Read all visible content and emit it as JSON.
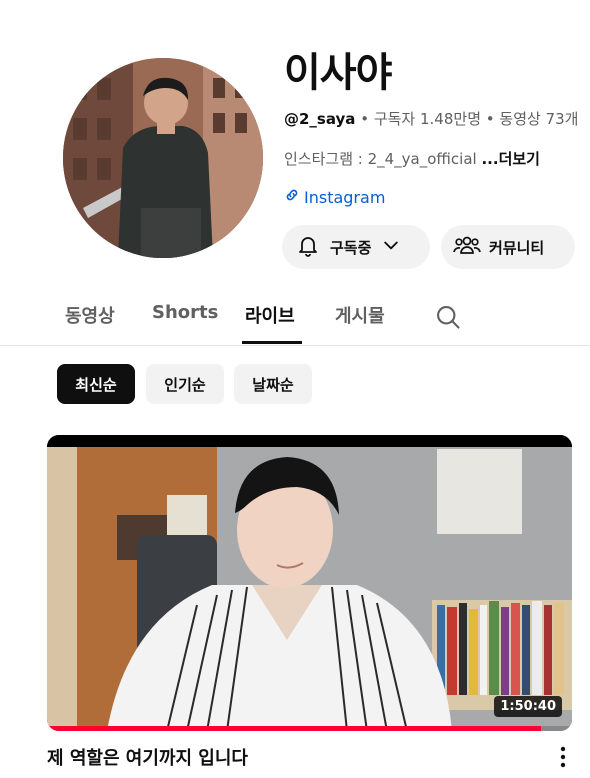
{
  "channel": {
    "name": "이사야",
    "handle": "@2_saya",
    "separator": " • ",
    "subscribers": "구독자 1.48만명",
    "videos": "동영상 73개",
    "description": "인스타그램 : 2_4_ya_official ",
    "more_label": "...더보기",
    "link_label": "Instagram"
  },
  "actions": {
    "subscribe_label": "구독중",
    "community_label": "커뮤니티"
  },
  "tabs": [
    {
      "label": "동영상",
      "active": false
    },
    {
      "label": "Shorts",
      "active": false
    },
    {
      "label": "라이브",
      "active": true
    },
    {
      "label": "게시물",
      "active": false
    }
  ],
  "chips": [
    {
      "label": "최신순",
      "active": true
    },
    {
      "label": "인기순",
      "active": false
    },
    {
      "label": "날짜순",
      "active": false
    }
  ],
  "video": {
    "title": "제 역할은 여기까지 입니다",
    "duration": "1:50:40",
    "watched_fraction": 0.94
  },
  "colors": {
    "accent_red": "#ff0033",
    "link_blue": "#065fd4",
    "chip_bg": "#f2f2f2"
  },
  "icons": [
    "bell-icon",
    "chevron-down-icon",
    "people-icon",
    "link-icon",
    "search-icon",
    "kebab-icon"
  ]
}
